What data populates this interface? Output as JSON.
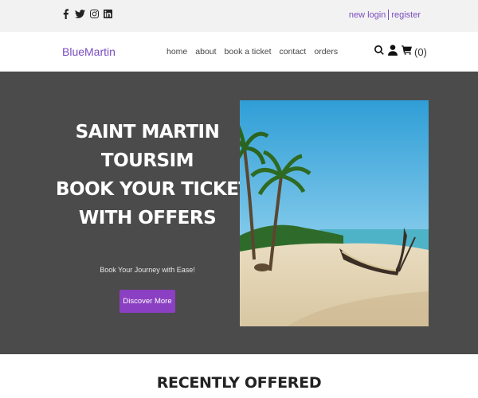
{
  "topbar": {
    "social": [
      {
        "icon": "facebook-icon"
      },
      {
        "icon": "twitter-icon"
      },
      {
        "icon": "instagram-icon"
      },
      {
        "icon": "linkedin-icon"
      }
    ],
    "login_label": "new login",
    "register_label": "register"
  },
  "navbar": {
    "brand": "BlueMartin",
    "menu": [
      {
        "label": "home"
      },
      {
        "label": "about"
      },
      {
        "label": "book a ticket"
      },
      {
        "label": "contact"
      },
      {
        "label": "orders"
      }
    ],
    "cart_count": "(0)"
  },
  "hero": {
    "title_lines": [
      "SAINT MARTIN",
      "TOURSIM",
      "BOOK YOUR TICKET",
      "WITH OFFERS"
    ],
    "subtitle": "Book Your Journey with Ease!",
    "button_label": "Discover More",
    "image": "beach-boat-photo"
  },
  "section": {
    "title": "RECENTLY OFFERED"
  },
  "colors": {
    "accent": "#7a4cc0",
    "button": "#8b3fc2",
    "hero_bg": "#4b4b4b",
    "topbar_bg": "#f2f2f2"
  }
}
